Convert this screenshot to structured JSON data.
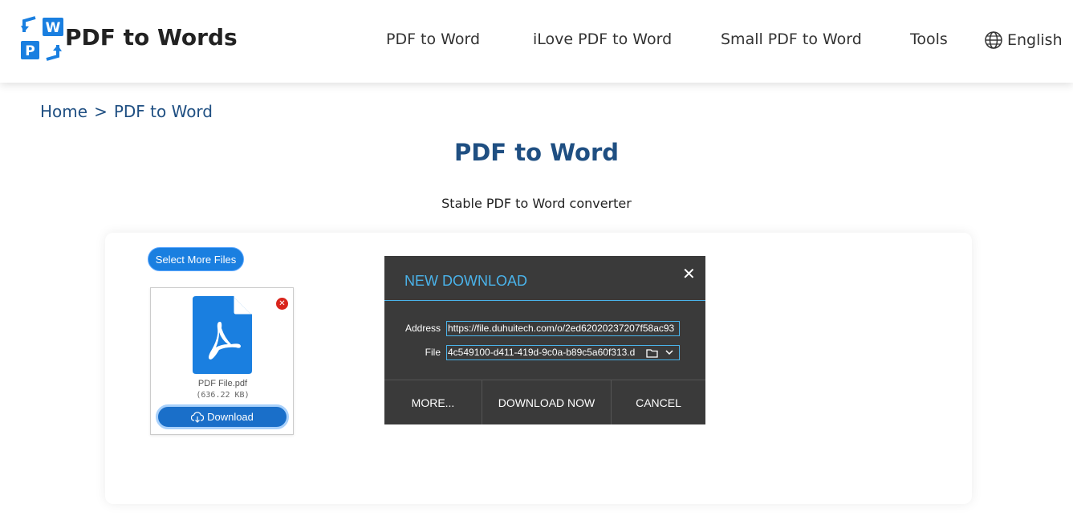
{
  "header": {
    "brand": "PDF to Words",
    "nav": [
      "PDF to Word",
      "iLove PDF to Word",
      "Small PDF to Word",
      "Tools"
    ],
    "language": "English"
  },
  "breadcrumb": {
    "home": "Home",
    "sep": ">",
    "current": "PDF to Word"
  },
  "page": {
    "title": "PDF to Word",
    "subtitle": "Stable PDF to Word converter"
  },
  "upload": {
    "select_more": "Select More Files",
    "file": {
      "name": "PDF File.pdf",
      "size": "(636.22 KB)",
      "download_label": "Download"
    }
  },
  "dialog": {
    "title": "NEW DOWNLOAD",
    "address_label": "Address",
    "address_value": "https://file.duhuitech.com/o/2ed62020237207f58ac93",
    "file_label": "File",
    "file_value": "4c549100-d411-419d-9c0a-b89c5a60f313.d",
    "buttons": {
      "more": "MORE...",
      "download_now": "DOWNLOAD NOW",
      "cancel": "CANCEL"
    }
  },
  "colors": {
    "title_blue": "#1f4f82",
    "button_blue": "#1a7fe0",
    "dialog_accent": "#4ab3ea",
    "dialog_bg": "#3a3a3a"
  }
}
